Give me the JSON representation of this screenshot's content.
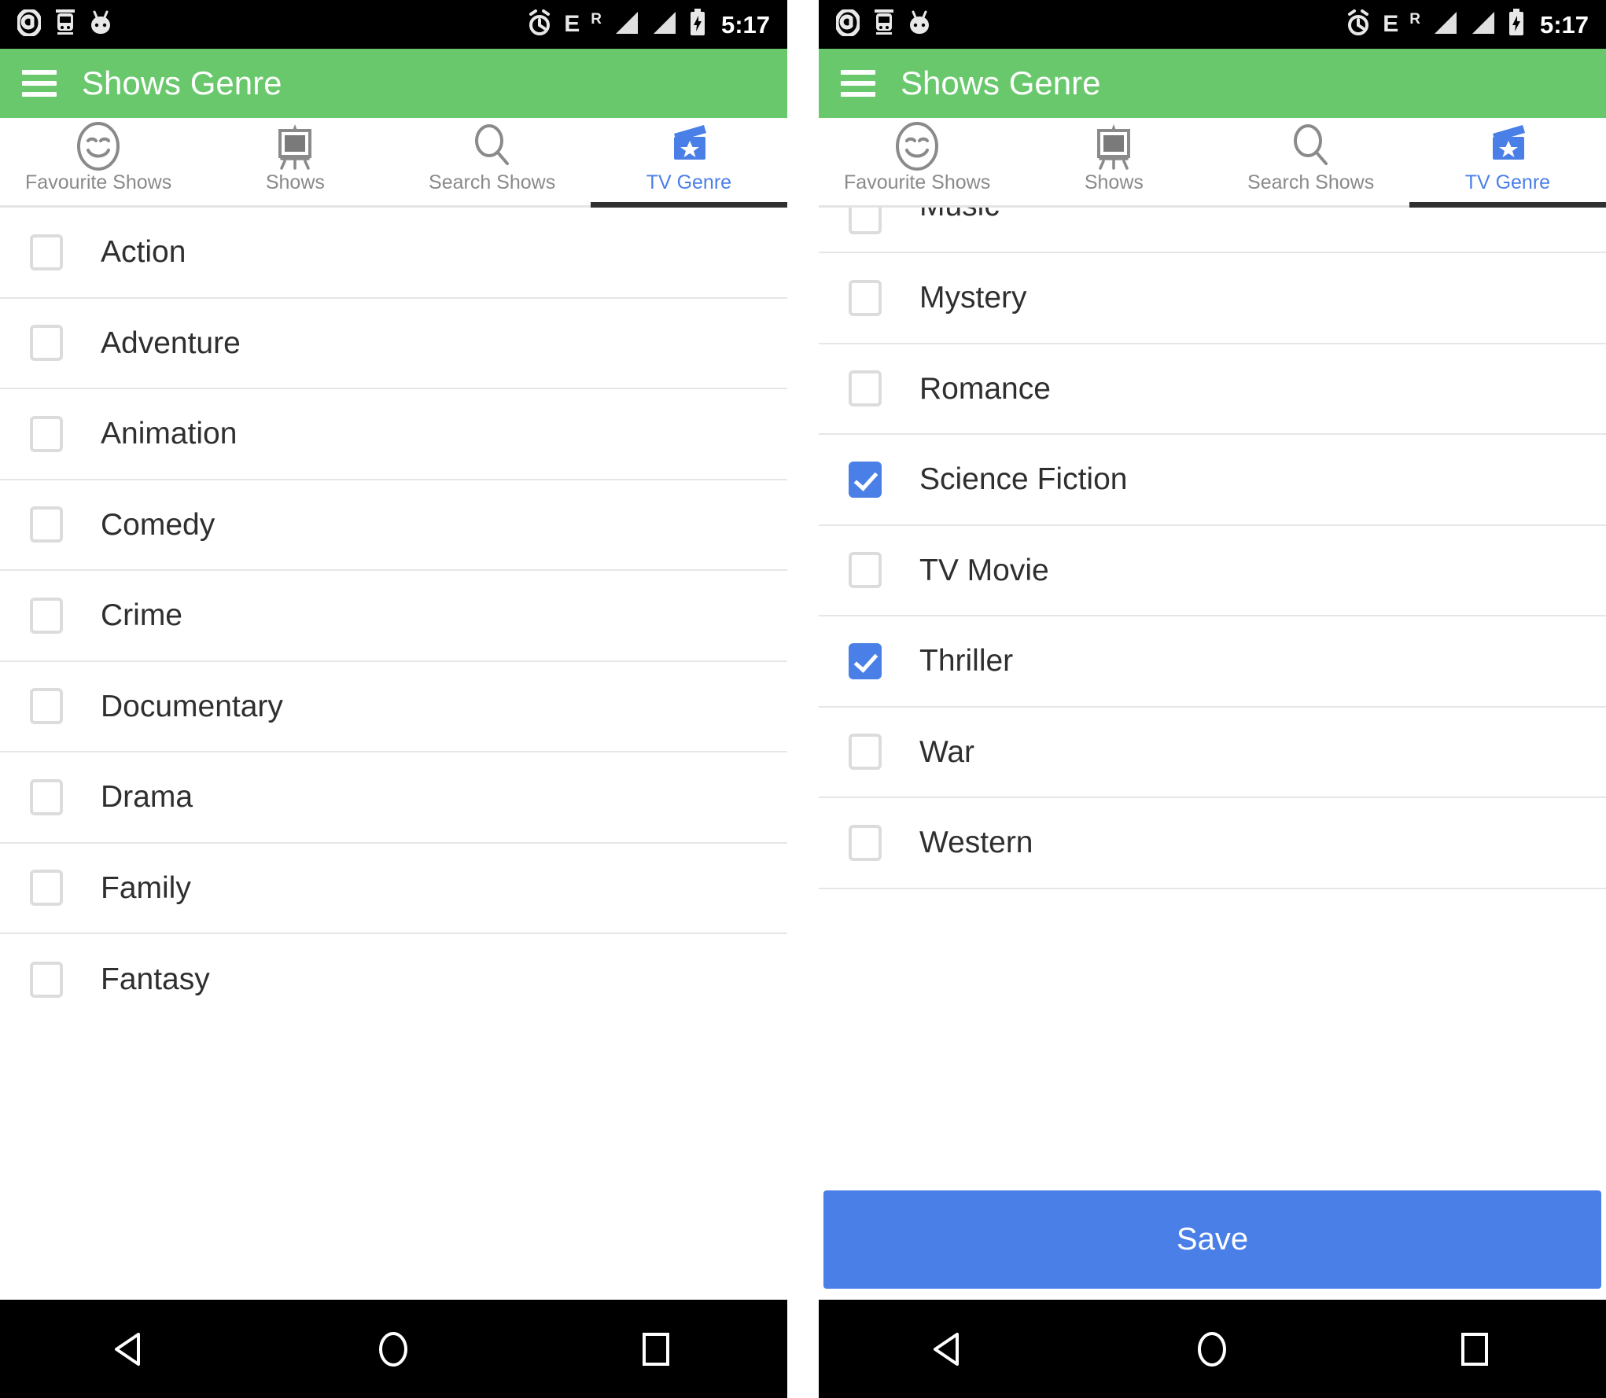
{
  "status_bar": {
    "left_icons": [
      "app-circle-icon",
      "tram-icon",
      "android-icon"
    ],
    "right_icons": [
      "alarm-clock-icon",
      "signal-bars-icon",
      "signal-bars-icon",
      "battery-charging-icon"
    ],
    "network_type": "E",
    "roaming": "R",
    "time": "5:17"
  },
  "app_bar": {
    "menu_icon": "hamburger-menu-icon",
    "title": "Shows Genre"
  },
  "tabs": [
    {
      "label": "Favourite Shows",
      "icon": "smiley-face-icon",
      "active": false
    },
    {
      "label": "Shows",
      "icon": "easel-tv-icon",
      "active": false
    },
    {
      "label": "Search Shows",
      "icon": "magnifying-glass-icon",
      "active": false
    },
    {
      "label": "TV Genre",
      "icon": "clapperboard-star-icon",
      "active": true
    }
  ],
  "colors": {
    "app_bar_green": "#69C86C",
    "accent_blue": "#4A7FE8",
    "tab_inactive_gray": "#8A8A8A",
    "checkbox_border": "#DCDCDC",
    "divider": "#E6E6E6",
    "status_bar_black": "#000000"
  },
  "left_panel": {
    "genres": [
      {
        "label": "Action",
        "checked": false
      },
      {
        "label": "Adventure",
        "checked": false
      },
      {
        "label": "Animation",
        "checked": false
      },
      {
        "label": "Comedy",
        "checked": false
      },
      {
        "label": "Crime",
        "checked": false
      },
      {
        "label": "Documentary",
        "checked": false
      },
      {
        "label": "Drama",
        "checked": false
      },
      {
        "label": "Family",
        "checked": false
      },
      {
        "label": "Fantasy",
        "checked": false
      }
    ]
  },
  "right_panel": {
    "clipped_top_genre": {
      "label": "Music",
      "checked": false
    },
    "genres": [
      {
        "label": "Mystery",
        "checked": false
      },
      {
        "label": "Romance",
        "checked": false
      },
      {
        "label": "Science Fiction",
        "checked": true
      },
      {
        "label": "TV Movie",
        "checked": false
      },
      {
        "label": "Thriller",
        "checked": true
      },
      {
        "label": "War",
        "checked": false
      },
      {
        "label": "Western",
        "checked": false
      }
    ],
    "save_label": "Save"
  },
  "nav_bar": {
    "back": "back-triangle-icon",
    "home": "home-circle-icon",
    "recents": "recents-square-icon"
  }
}
